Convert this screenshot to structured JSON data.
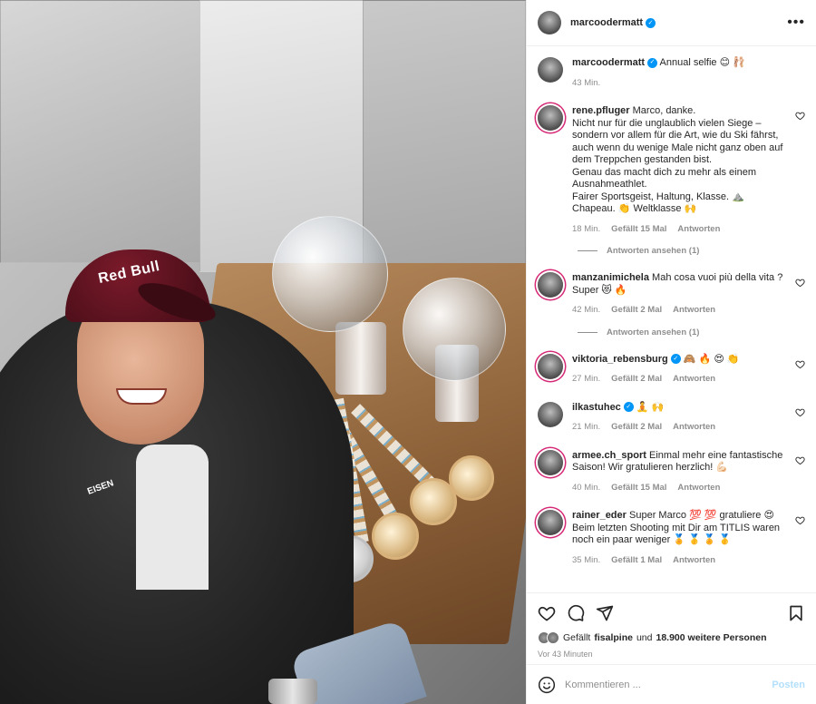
{
  "post": {
    "author": "marcoodermatt",
    "caption_user": "marcoodermatt",
    "caption_text": "Annual selfie 😊 🩰",
    "caption_time": "43 Min.",
    "photo_cap_text": "Red Bull",
    "photo_jacket_text": "EISEN"
  },
  "comments": [
    {
      "user": "rene.pfluger",
      "text": "Marco, danke.\nNicht nur für die unglaublich vielen Siege – sondern vor allem für die Art, wie du Ski fährst, auch wenn du wenige Male nicht ganz oben auf dem Treppchen gestanden bist.\nGenau das macht dich zu mehr als einem Ausnahmeathlet.\nFairer Sportsgeist, Haltung, Klasse. ⛰️\nChapeau. 👏 Weltklasse 🙌",
      "time": "18 Min.",
      "likes": "Gefällt 15 Mal",
      "reply": "Antworten",
      "replies": "Antworten ansehen (1)",
      "verified": false
    },
    {
      "user": "manzanimichela",
      "text": "Mah cosa vuoi più della vita ? Super 😻 🔥",
      "time": "42 Min.",
      "likes": "Gefällt 2 Mal",
      "reply": "Antworten",
      "replies": "Antworten ansehen (1)",
      "verified": false
    },
    {
      "user": "viktoria_rebensburg",
      "text": "🙈 🔥 😍 👏",
      "time": "27 Min.",
      "likes": "Gefällt 2 Mal",
      "reply": "Antworten",
      "verified": true
    },
    {
      "user": "ilkastuhec",
      "text": "🧘 🙌",
      "time": "21 Min.",
      "likes": "Gefällt 2 Mal",
      "reply": "Antworten",
      "verified": true
    },
    {
      "user": "armee.ch_sport",
      "text": "Einmal mehr eine fantastische Saison! Wir gratulieren herzlich! 💪🏻",
      "time": "40 Min.",
      "likes": "Gefällt 15 Mal",
      "reply": "Antworten",
      "verified": false
    },
    {
      "user": "rainer_eder",
      "text": "Super Marco 💯 💯 gratuliere 😍\nBeim letzten Shooting mit Dir am TITLIS waren noch ein paar weniger 🏅 🥇 🏅 🥇",
      "time": "35 Min.",
      "likes": "Gefällt 1 Mal",
      "reply": "Antworten",
      "verified": false
    }
  ],
  "likes_line": {
    "prefix": "Gefällt",
    "user": "fisalpine",
    "middle": "und",
    "others": "18.900 weitere Personen"
  },
  "time_ago": "Vor 43 Minuten",
  "comment_input": {
    "placeholder": "Kommentieren ..."
  },
  "post_button": "Posten",
  "colors": {
    "accent": "#0095f6",
    "post_disabled": "#b2dffc",
    "muted": "#8e8e8e"
  }
}
